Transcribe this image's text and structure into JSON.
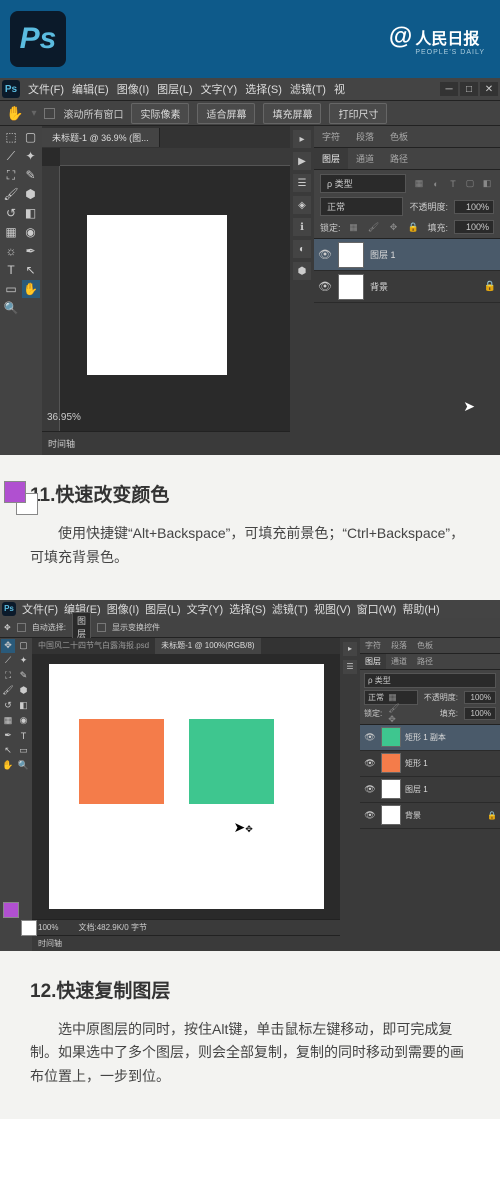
{
  "header": {
    "logo": "Ps",
    "brand_at": "@",
    "brand_name": "人民日报",
    "brand_sub": "PEOPLE'S DAILY"
  },
  "ps1": {
    "menu": [
      "文件(F)",
      "编辑(E)",
      "图像(I)",
      "图层(L)",
      "文字(Y)",
      "选择(S)",
      "滤镜(T)",
      "视"
    ],
    "opt_scroll": "滚动所有窗口",
    "opt_btns": [
      "实际像素",
      "适合屏幕",
      "填充屏幕",
      "打印尺寸"
    ],
    "tab": "未标题-1 @ 36.9% (图...",
    "zoom": "36.95%",
    "timeline": "时间轴",
    "panel_tabs1": [
      "字符",
      "段落",
      "色板"
    ],
    "panel_tabs2": [
      "图层",
      "通道",
      "路径"
    ],
    "kind_label": "ρ 类型",
    "blend": "正常",
    "opacity_label": "不透明度:",
    "opacity_val": "100%",
    "lock_label": "锁定:",
    "fill_label": "填充:",
    "fill_val": "100%",
    "layers": [
      {
        "name": "图层 1",
        "selected": true,
        "locked": false
      },
      {
        "name": "背景",
        "selected": false,
        "locked": true
      }
    ]
  },
  "tip11": {
    "title": "11.快速改变颜色",
    "body": "使用快捷键“Alt+Backspace”，可填充前景色；“Ctrl+Backspace”，可填充背景色。"
  },
  "ps2": {
    "menu": [
      "文件(F)",
      "编辑(E)",
      "图像(I)",
      "图层(L)",
      "文字(Y)",
      "选择(S)",
      "滤镜(T)",
      "视图(V)",
      "窗口(W)",
      "帮助(H)"
    ],
    "opt_auto": "自动选择:",
    "opt_layer": "图层",
    "opt_transform": "显示变换控件",
    "tab1": "中国风二十四节气白露海报.psd",
    "tab2": "未标题-1 @ 100%(RGB/8)",
    "status_zoom": "100%",
    "status_doc": "文档:482.9K/0 字节",
    "timeline": "时间轴",
    "panel_tabs1": [
      "字符",
      "段落",
      "色板"
    ],
    "panel_tabs2": [
      "图层",
      "通道",
      "路径"
    ],
    "kind_label": "ρ 类型",
    "blend": "正常",
    "opacity_label": "不透明度:",
    "opacity_val": "100%",
    "lock_label": "锁定:",
    "fill_label": "填充:",
    "fill_val": "100%",
    "layers": [
      {
        "name": "矩形 1 副本",
        "color": "#3ec68f",
        "selected": true
      },
      {
        "name": "矩形 1",
        "color": "#f47c4a",
        "selected": false
      },
      {
        "name": "图层 1",
        "color": "#fff",
        "selected": false
      },
      {
        "name": "背景",
        "color": "#fff",
        "selected": false,
        "locked": true
      }
    ]
  },
  "tip12": {
    "title": "12.快速复制图层",
    "body": "选中原图层的同时，按住Alt键，单击鼠标左键移动，即可完成复制。如果选中了多个图层，则会全部复制，复制的同时移动到需要的画布位置上，一步到位。"
  }
}
